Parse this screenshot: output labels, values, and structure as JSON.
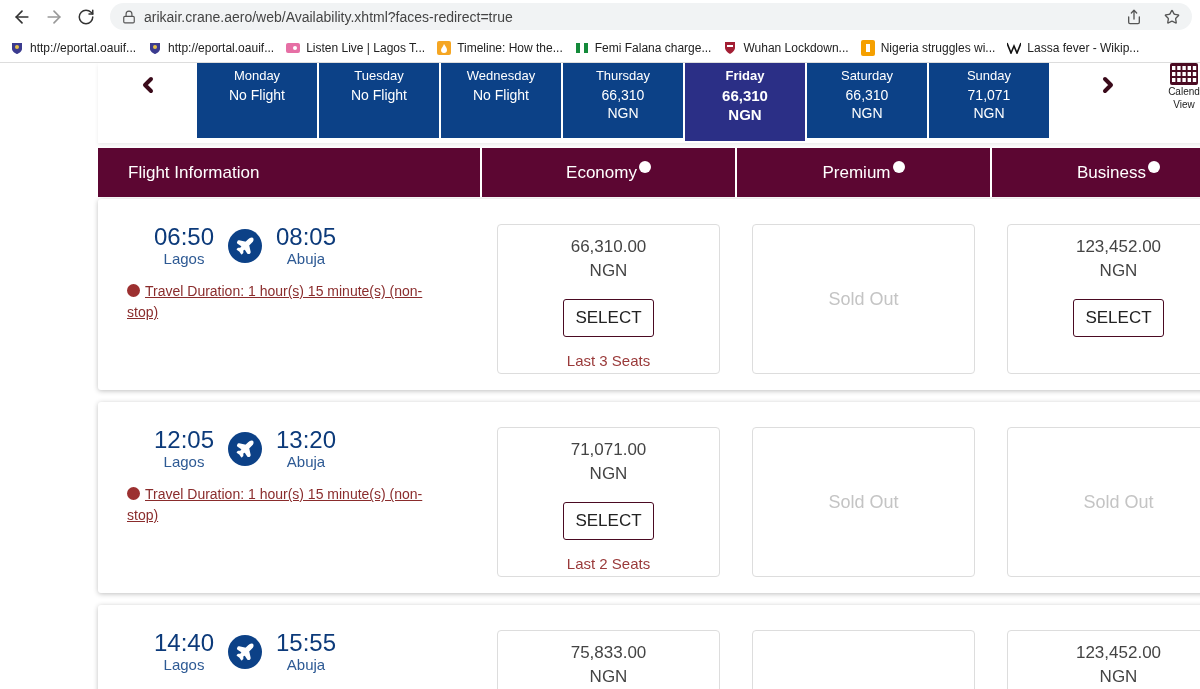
{
  "browser": {
    "url": "arikair.crane.aero/web/Availability.xhtml?faces-redirect=true"
  },
  "bookmarks": [
    {
      "label": "http://eportal.oauif...",
      "kind": "crest"
    },
    {
      "label": "http://eportal.oauif...",
      "kind": "crest"
    },
    {
      "label": "Listen Live | Lagos T...",
      "kind": "radio"
    },
    {
      "label": "Timeline: How the...",
      "kind": "flame"
    },
    {
      "label": "Femi Falana charge...",
      "kind": "flag"
    },
    {
      "label": "Wuhan Lockdown...",
      "kind": "shield"
    },
    {
      "label": "Nigeria struggles wi...",
      "kind": "bracket"
    },
    {
      "label": "Lassa fever - Wikip...",
      "kind": "wiki"
    }
  ],
  "date_tabs": [
    {
      "day": "Monday",
      "lines": [
        "No Flight"
      ],
      "selected": false
    },
    {
      "day": "Tuesday",
      "lines": [
        "No Flight"
      ],
      "selected": false
    },
    {
      "day": "Wednesday",
      "lines": [
        "No Flight"
      ],
      "selected": false
    },
    {
      "day": "Thursday",
      "lines": [
        "66,310",
        "NGN"
      ],
      "selected": false
    },
    {
      "day": "Friday",
      "lines": [
        "66,310",
        "NGN"
      ],
      "selected": true
    },
    {
      "day": "Saturday",
      "lines": [
        "66,310",
        "NGN"
      ],
      "selected": false
    },
    {
      "day": "Sunday",
      "lines": [
        "71,071",
        "NGN"
      ],
      "selected": false
    }
  ],
  "calendar_view": [
    "Calend",
    "View"
  ],
  "table_header": {
    "flight_info": "Flight Information",
    "cabins": [
      "Economy",
      "Premium",
      "Business"
    ]
  },
  "flights": [
    {
      "departure": "06:50",
      "from": "Lagos",
      "arrival": "08:05",
      "to": "Abuja",
      "duration": "Travel Duration: 1 hour(s) 15 minute(s) (non-stop)",
      "fares": [
        {
          "kind": "price",
          "amount": "66,310.00",
          "currency": "NGN",
          "button": "SELECT",
          "note": "Last 3 Seats"
        },
        {
          "kind": "soldout",
          "text": "Sold Out"
        },
        {
          "kind": "price",
          "amount": "123,452.00",
          "currency": "NGN",
          "button": "SELECT"
        }
      ]
    },
    {
      "departure": "12:05",
      "from": "Lagos",
      "arrival": "13:20",
      "to": "Abuja",
      "duration": "Travel Duration: 1 hour(s) 15 minute(s) (non-stop)",
      "fares": [
        {
          "kind": "price",
          "amount": "71,071.00",
          "currency": "NGN",
          "button": "SELECT",
          "note": "Last 2 Seats"
        },
        {
          "kind": "soldout",
          "text": "Sold Out"
        },
        {
          "kind": "soldout",
          "text": "Sold Out"
        }
      ]
    },
    {
      "departure": "14:40",
      "from": "Lagos",
      "arrival": "15:55",
      "to": "Abuja",
      "fares": [
        {
          "kind": "price",
          "amount": "75,833.00",
          "currency": "NGN"
        },
        {
          "kind": "empty"
        },
        {
          "kind": "price",
          "amount": "123,452.00",
          "currency": "NGN"
        }
      ]
    }
  ]
}
